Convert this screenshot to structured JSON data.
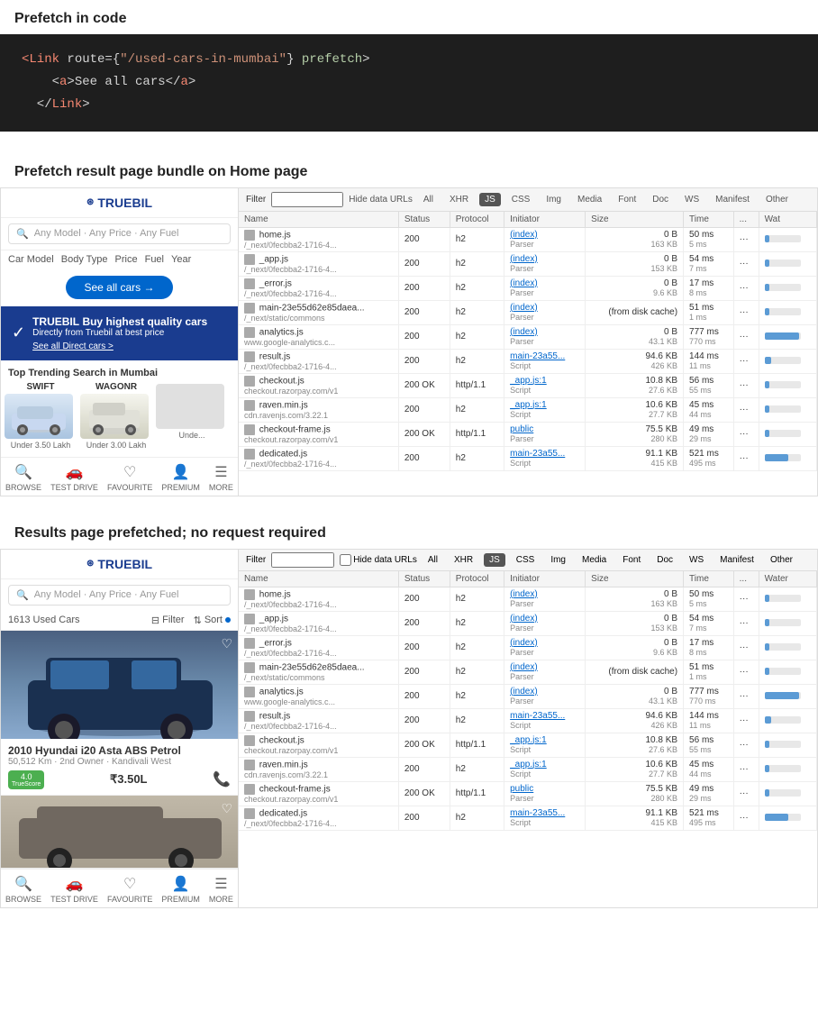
{
  "sections": {
    "prefetch_code": {
      "title": "Prefetch in code",
      "code_lines": [
        {
          "parts": [
            {
              "text": "<",
              "class": "kw-red"
            },
            {
              "text": "Link",
              "class": "kw-red"
            },
            {
              "text": " route=",
              "class": "kw-white"
            },
            {
              "text": "{",
              "class": "kw-white"
            },
            {
              "text": "\"/used-cars-in-mumbai\"",
              "class": "kw-str"
            },
            {
              "text": "}",
              "class": "kw-white"
            },
            {
              "text": " prefetch",
              "class": "kw-green"
            },
            {
              "text": ">",
              "class": "kw-white"
            }
          ]
        },
        {
          "parts": [
            {
              "text": "    <",
              "class": "kw-white"
            },
            {
              "text": "a",
              "class": "kw-red"
            },
            {
              "text": ">See all cars</",
              "class": "kw-white"
            },
            {
              "text": "a",
              "class": "kw-red"
            },
            {
              "text": ">",
              "class": "kw-white"
            }
          ]
        },
        {
          "parts": [
            {
              "text": "  </",
              "class": "kw-white"
            },
            {
              "text": "Link",
              "class": "kw-red"
            },
            {
              "text": ">",
              "class": "kw-white"
            }
          ]
        }
      ]
    },
    "prefetch_result": {
      "title": "Prefetch result page bundle on Home page",
      "network_toolbar": {
        "filter_label": "Filter",
        "hide_data_urls": "Hide data URLs",
        "tabs": [
          "All",
          "XHR",
          "JS",
          "CSS",
          "Img",
          "Media",
          "Font",
          "Doc",
          "WS",
          "Manifest",
          "Other"
        ],
        "active_tab": "JS"
      },
      "network_columns": [
        "Name",
        "Status",
        "Protocol",
        "Initiator",
        "Size",
        "Time",
        "",
        "Wat"
      ],
      "network_rows": [
        {
          "name": "home.js",
          "path": "/_next/0fecbba2-1716-4...",
          "status": "200",
          "protocol": "h2",
          "initiator": "(index)",
          "initiator_type": "Parser",
          "size": "0 B",
          "size_kb": "163 KB",
          "time": "50 ms",
          "time2": "5 ms"
        },
        {
          "name": "_app.js",
          "path": "/_next/0fecbba2-1716-4...",
          "status": "200",
          "protocol": "h2",
          "initiator": "(index)",
          "initiator_type": "Parser",
          "size": "0 B",
          "size_kb": "153 KB",
          "time": "54 ms",
          "time2": "7 ms"
        },
        {
          "name": "_error.js",
          "path": "/_next/0fecbba2-1716-4...",
          "status": "200",
          "protocol": "h2",
          "initiator": "(index)",
          "initiator_type": "Parser",
          "size": "0 B",
          "size_kb": "9.6 KB",
          "time": "17 ms",
          "time2": "8 ms"
        },
        {
          "name": "main-23e55d62e85daea...",
          "path": "/_next/static/commons",
          "status": "200",
          "protocol": "h2",
          "initiator": "(index)",
          "initiator_type": "Parser",
          "size": "(from disk cache)",
          "size_kb": "",
          "time": "51 ms",
          "time2": "1 ms"
        },
        {
          "name": "analytics.js",
          "path": "www.google-analytics.c...",
          "status": "200",
          "protocol": "h2",
          "initiator": "(index)",
          "initiator_type": "Parser",
          "size": "0 B",
          "size_kb": "43.1 KB",
          "time": "777 ms",
          "time2": "770 ms"
        },
        {
          "name": "result.js",
          "path": "/_next/0fecbba2-1716-4...",
          "status": "200",
          "protocol": "h2",
          "initiator": "main-23a55...",
          "initiator_type": "Script",
          "size": "94.6 KB",
          "size_kb": "426 KB",
          "time": "144 ms",
          "time2": "11 ms"
        },
        {
          "name": "checkout.js",
          "path": "checkout.razorpay.com/v1",
          "status": "200 OK",
          "protocol": "http/1.1",
          "initiator": "_app.js:1",
          "initiator_type": "Script",
          "size": "10.8 KB",
          "size_kb": "27.6 KB",
          "time": "56 ms",
          "time2": "55 ms"
        },
        {
          "name": "raven.min.js",
          "path": "cdn.ravenjs.com/3.22.1",
          "status": "200",
          "protocol": "h2",
          "initiator": "_app.js:1",
          "initiator_type": "Script",
          "size": "10.6 KB",
          "size_kb": "27.7 KB",
          "time": "45 ms",
          "time2": "44 ms"
        },
        {
          "name": "checkout-frame.js",
          "path": "checkout.razorpay.com/v1",
          "status": "200 OK",
          "protocol": "http/1.1",
          "initiator": "public",
          "initiator_type": "Parser",
          "size": "75.5 KB",
          "size_kb": "280 KB",
          "time": "49 ms",
          "time2": "29 ms"
        },
        {
          "name": "dedicated.js",
          "path": "/_next/0fecbba2-1716-4...",
          "status": "200",
          "protocol": "h2",
          "initiator": "main-23a55...",
          "initiator_type": "Script",
          "size": "91.1 KB",
          "size_kb": "415 KB",
          "time": "521 ms",
          "time2": "495 ms"
        }
      ]
    },
    "results_prefetched": {
      "title": "Results page prefetched; no request required",
      "listing": {
        "count": "1613 Used Cars",
        "filter_label": "Filter",
        "sort_label": "Sort"
      },
      "car1": {
        "name": "2010 Hyundai i20 Asta ABS Petrol",
        "details": "50,512 Km · 2nd Owner · Kandivali West",
        "score": "4.0",
        "score_label": "TrueScore",
        "price": "₹3.50L"
      },
      "network_rows2": [
        {
          "name": "home.js",
          "path": "/_next/0fecbba2-1716-4...",
          "status": "200",
          "protocol": "h2",
          "initiator": "(index)",
          "initiator_type": "Parser",
          "size": "0 B",
          "size_kb": "163 KB",
          "time": "50 ms",
          "time2": "5 ms"
        },
        {
          "name": "_app.js",
          "path": "/_next/0fecbba2-1716-4...",
          "status": "200",
          "protocol": "h2",
          "initiator": "(index)",
          "initiator_type": "Parser",
          "size": "0 B",
          "size_kb": "153 KB",
          "time": "54 ms",
          "time2": "7 ms"
        },
        {
          "name": "_error.js",
          "path": "/_next/0fecbba2-1716-4...",
          "status": "200",
          "protocol": "h2",
          "initiator": "(index)",
          "initiator_type": "Parser",
          "size": "0 B",
          "size_kb": "9.6 KB",
          "time": "17 ms",
          "time2": "8 ms"
        },
        {
          "name": "main-23e55d62e85daea...",
          "path": "/_next/static/commons",
          "status": "200",
          "protocol": "h2",
          "initiator": "(index)",
          "initiator_type": "Parser",
          "size": "(from disk cache)",
          "size_kb": "",
          "time": "51 ms",
          "time2": "1 ms"
        },
        {
          "name": "analytics.js",
          "path": "www.google-analytics.c...",
          "status": "200",
          "protocol": "h2",
          "initiator": "(index)",
          "initiator_type": "Parser",
          "size": "0 B",
          "size_kb": "43.1 KB",
          "time": "777 ms",
          "time2": "770 ms"
        },
        {
          "name": "result.js",
          "path": "/_next/0fecbba2-1716-4...",
          "status": "200",
          "protocol": "h2",
          "initiator": "main-23a55...",
          "initiator_type": "Script",
          "size": "94.6 KB",
          "size_kb": "426 KB",
          "time": "144 ms",
          "time2": "11 ms"
        },
        {
          "name": "checkout.js",
          "path": "checkout.razorpay.com/v1",
          "status": "200 OK",
          "protocol": "http/1.1",
          "initiator": "_app.js:1",
          "initiator_type": "Script",
          "size": "10.8 KB",
          "size_kb": "27.6 KB",
          "time": "56 ms",
          "time2": "55 ms"
        },
        {
          "name": "raven.min.js",
          "path": "cdn.ravenjs.com/3.22.1",
          "status": "200",
          "protocol": "h2",
          "initiator": "_app.js:1",
          "initiator_type": "Script",
          "size": "10.6 KB",
          "size_kb": "27.7 KB",
          "time": "45 ms",
          "time2": "44 ms"
        },
        {
          "name": "checkout-frame.js",
          "path": "checkout.razorpay.com/v1",
          "status": "200 OK",
          "protocol": "http/1.1",
          "initiator": "public",
          "initiator_type": "Parser",
          "size": "75.5 KB",
          "size_kb": "280 KB",
          "time": "49 ms",
          "time2": "29 ms"
        },
        {
          "name": "dedicated.js",
          "path": "/_next/0fecbba2-1716-4...",
          "status": "200",
          "protocol": "h2",
          "initiator": "main-23a55...",
          "initiator_type": "Script",
          "size": "91.1 KB",
          "size_kb": "415 KB",
          "time": "521 ms",
          "time2": "495 ms"
        }
      ]
    }
  },
  "truebil": {
    "logo_text": "TRUEBIL",
    "search_placeholder": "Any Model · Any Price · Any Fuel",
    "filters": [
      "Car Model",
      "Body Type",
      "Price",
      "Fuel",
      "Year"
    ],
    "see_all_btn": "See all cars →",
    "banner_title": "Buy highest quality cars",
    "banner_sub": "Directly from Truebil at best price",
    "banner_link": "See all Direct cars >",
    "trending_title": "Top Trending Search in Mumbai",
    "cars": [
      {
        "name": "SWIFT",
        "price": "Under 3.50 Lakh"
      },
      {
        "name": "WAGONR",
        "price": "Under 3.00 Lakh"
      },
      {
        "name": "",
        "price": "Unde..."
      }
    ],
    "nav_items": [
      "BROWSE",
      "TEST DRIVE",
      "FAVOURITE",
      "PREMIUM",
      "MORE"
    ]
  }
}
